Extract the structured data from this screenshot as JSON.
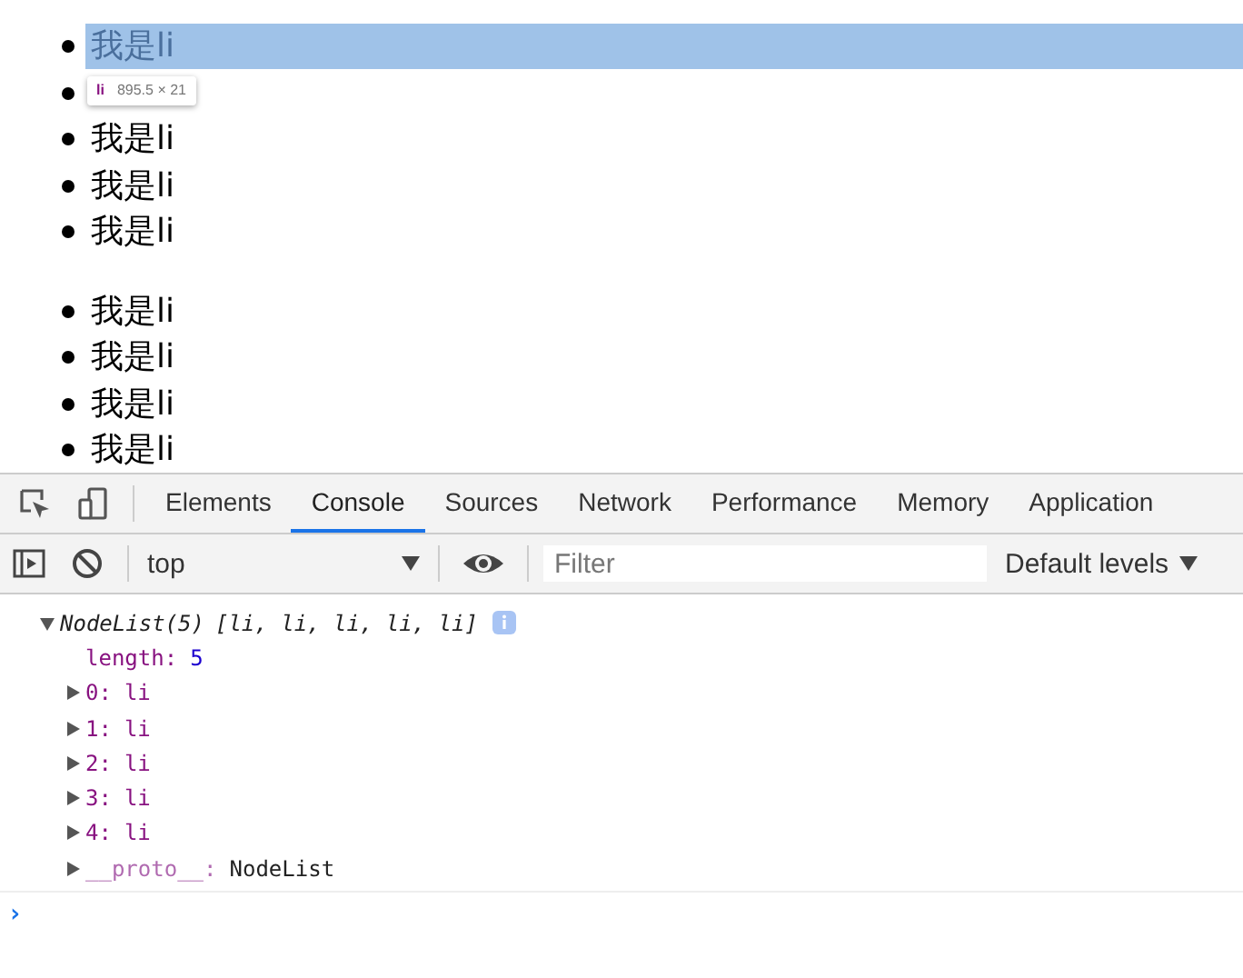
{
  "page": {
    "lists": [
      {
        "items": [
          {
            "text": "我是li",
            "highlighted": true
          },
          {
            "highlighted": false
          },
          {
            "text": "我是li",
            "highlighted": false
          },
          {
            "text": "我是li",
            "highlighted": false
          },
          {
            "text": "我是li",
            "highlighted": false
          }
        ]
      },
      {
        "items": [
          {
            "text": "我是li",
            "highlighted": false
          },
          {
            "text": "我是li",
            "highlighted": false
          },
          {
            "text": "我是li",
            "highlighted": false
          },
          {
            "text": "我是li",
            "highlighted": false
          }
        ]
      }
    ],
    "tooltip": {
      "tag": "li",
      "size": "895.5 × 21"
    }
  },
  "devtools": {
    "tabs": [
      {
        "label": "Elements",
        "selected": false
      },
      {
        "label": "Console",
        "selected": true
      },
      {
        "label": "Sources",
        "selected": false
      },
      {
        "label": "Network",
        "selected": false
      },
      {
        "label": "Performance",
        "selected": false
      },
      {
        "label": "Memory",
        "selected": false
      },
      {
        "label": "Application",
        "selected": false
      }
    ],
    "toolbar": {
      "context": "top",
      "filter": {
        "placeholder": "Filter"
      },
      "levels": "Default levels"
    },
    "console": {
      "expanded": true,
      "title": "NodeList(5)",
      "preview": "[li, li, li, li, li]",
      "entries": [
        {
          "key": "length:",
          "value": "5",
          "kind": "number",
          "expandable": false
        },
        {
          "key": "0:",
          "value": "li",
          "kind": "node",
          "expandable": true
        },
        {
          "key": "1:",
          "value": "li",
          "kind": "node",
          "expandable": true
        },
        {
          "key": "2:",
          "value": "li",
          "kind": "node",
          "expandable": true
        },
        {
          "key": "3:",
          "value": "li",
          "kind": "node",
          "expandable": true
        },
        {
          "key": "4:",
          "value": "li",
          "kind": "node",
          "expandable": true
        },
        {
          "key": "__proto__:",
          "value": "NodeList",
          "kind": "proto",
          "expandable": true
        }
      ],
      "prompt": "›"
    }
  }
}
